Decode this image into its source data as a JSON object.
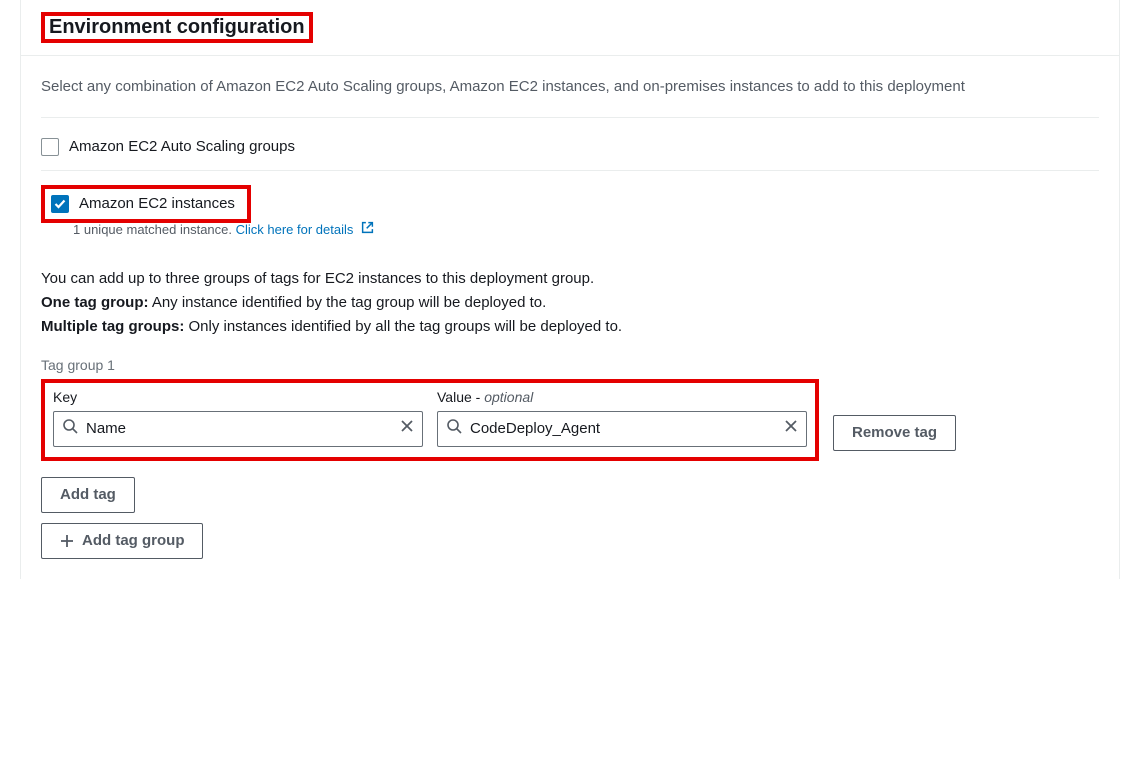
{
  "header": {
    "title": "Environment configuration"
  },
  "description": "Select any combination of Amazon EC2 Auto Scaling groups, Amazon EC2 instances, and on-premises instances to add to this deployment",
  "options": {
    "auto_scaling": {
      "label": "Amazon EC2 Auto Scaling groups",
      "checked": false
    },
    "ec2_instances": {
      "label": "Amazon EC2 instances",
      "checked": true,
      "match_prefix": "1 unique matched instance. ",
      "match_link": "Click here for details"
    }
  },
  "info": {
    "line1": "You can add up to three groups of tags for EC2 instances to this deployment group.",
    "one_label": "One tag group:",
    "one_text": " Any instance identified by the tag group will be deployed to.",
    "multi_label": "Multiple tag groups:",
    "multi_text": " Only instances identified by all the tag groups will be deployed to."
  },
  "tag_group": {
    "label": "Tag group 1",
    "key_label": "Key",
    "value_label": "Value - ",
    "value_optional": "optional",
    "key_value": "Name",
    "value_value": "CodeDeploy_Agent",
    "remove_tag": "Remove tag",
    "add_tag": "Add tag",
    "add_tag_group": "Add tag group"
  }
}
